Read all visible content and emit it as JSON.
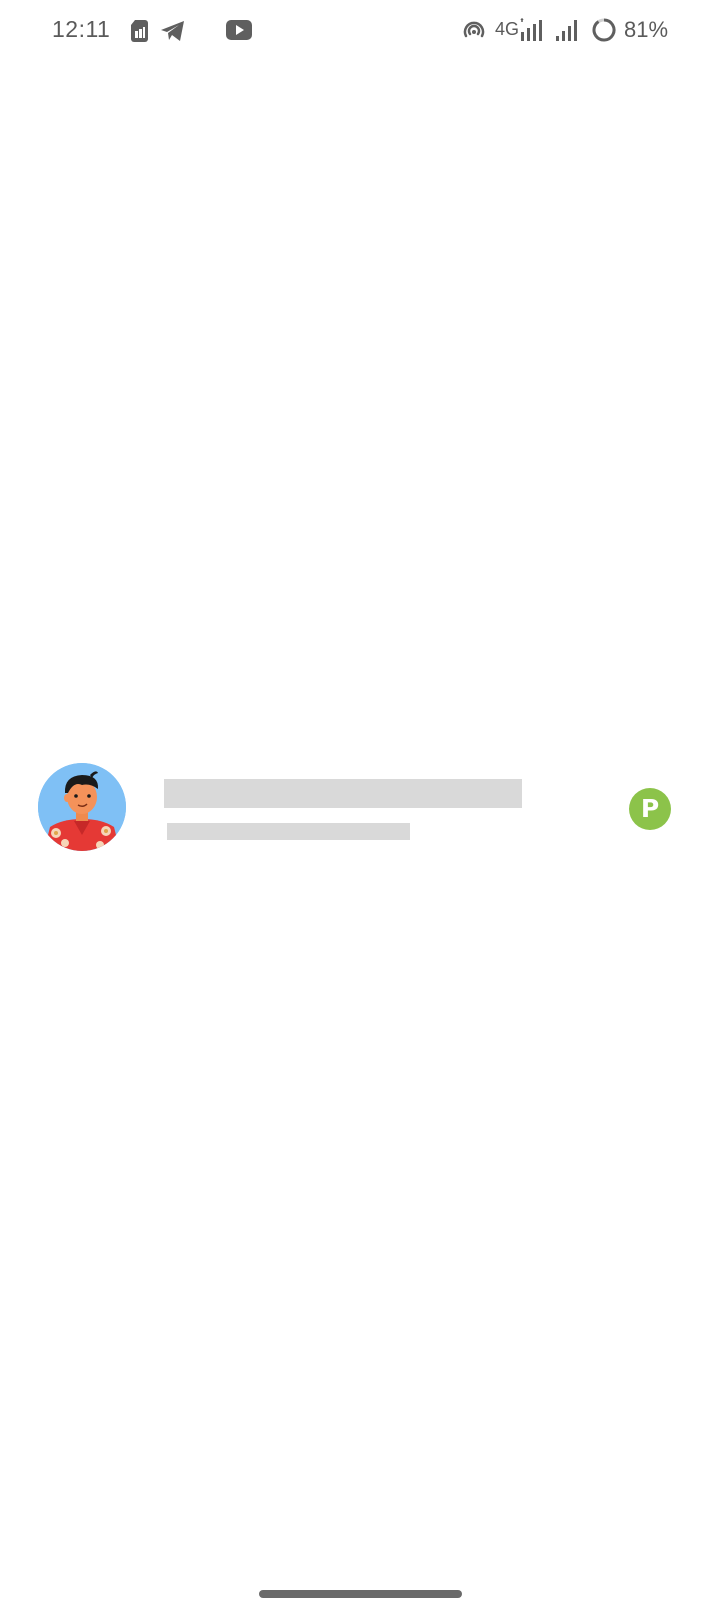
{
  "status_bar": {
    "time": "12:11",
    "network": "4G",
    "battery": "81%",
    "icons": [
      "sim-card-icon",
      "telegram-icon",
      "youtube-icon",
      "hotspot-icon",
      "signal-icon",
      "signal-icon-2",
      "battery-ring-icon"
    ]
  },
  "list": {
    "item": {
      "avatar": "avatar-icon",
      "badge": "P",
      "badge_color": "#8cc34a"
    }
  },
  "colors": {
    "skeleton": "#d9d9d9",
    "avatar_bg": "#7fc0f5",
    "indicator": "#6a6a6a"
  }
}
